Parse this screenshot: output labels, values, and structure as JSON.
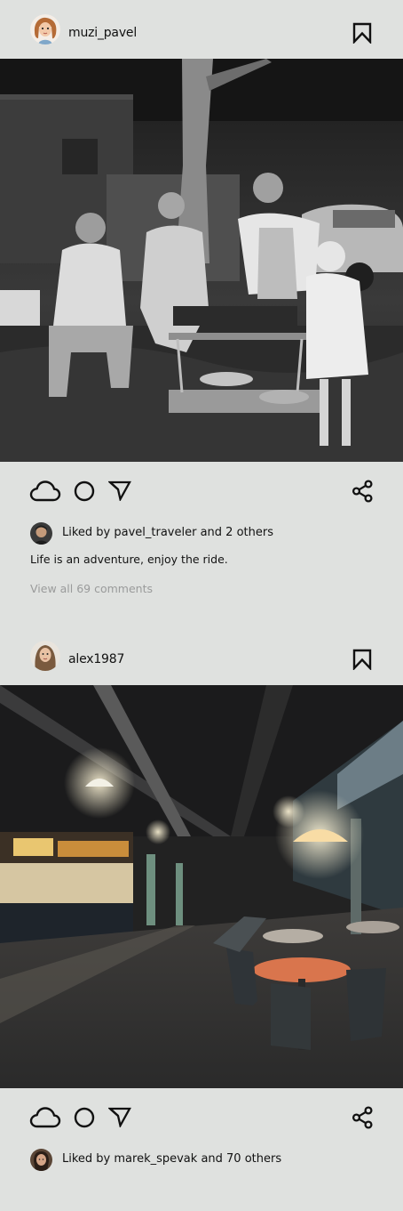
{
  "posts": [
    {
      "username": "muzi_pavel",
      "photo_alt": "Black and white vintage photo of a family around a barbecue grill",
      "liked_by_text": "Liked by pavel_traveler and 2 others",
      "caption": "Life is an adventure, enjoy the ride.",
      "comments_link": "View all 69 comments"
    },
    {
      "username": "alex1987",
      "photo_alt": "Empty food court with tables and chairs under hanging lamps",
      "liked_by_text": "Liked by marek_spevak and 70 others"
    }
  ],
  "icons": {
    "bookmark": "bookmark-icon",
    "like": "cloud-icon",
    "comment": "circle-icon",
    "send": "send-icon",
    "share": "share-icon"
  },
  "colors": {
    "background": "#dfe1df",
    "text": "#111111",
    "muted": "#9a9b9b"
  }
}
